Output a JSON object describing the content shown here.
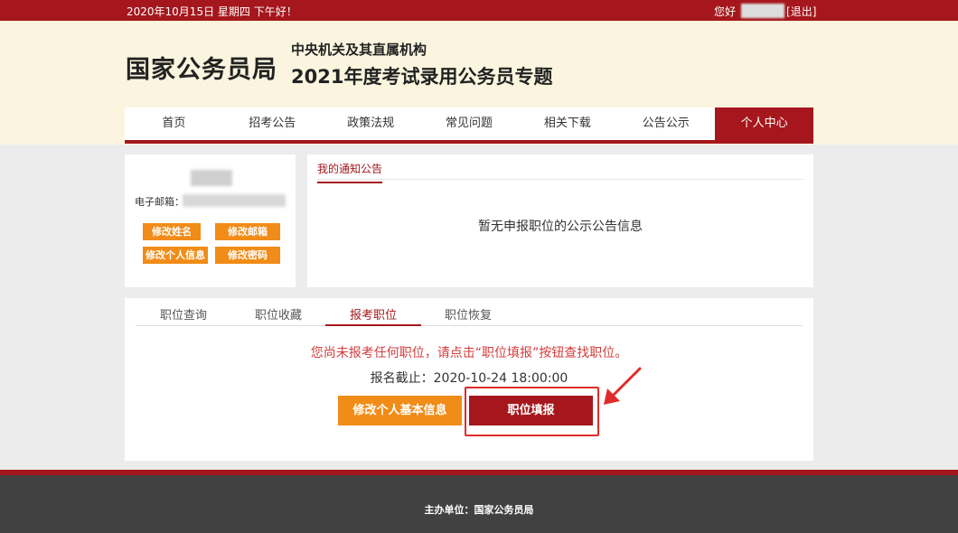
{
  "topbar": {
    "date_text": "2020年10月15日  星期四  下午好！",
    "greeting": "您好",
    "logout": "[退出]"
  },
  "header": {
    "logo": "国家公务员局",
    "subtitle_line1": "中央机关及其直属机构",
    "subtitle_line2": "2021年度考试录用公务员专题"
  },
  "nav": {
    "items": [
      "首页",
      "招考公告",
      "政策法规",
      "常见问题",
      "相关下载",
      "公告公示",
      "个人中心"
    ],
    "active": "个人中心"
  },
  "profile": {
    "email_label": "电子邮箱：",
    "buttons": [
      "修改姓名",
      "修改邮箱",
      "修改个人信息",
      "修改密码"
    ]
  },
  "notice": {
    "tab": "我的通知公告",
    "empty_message": "暂无申报职位的公示公告信息"
  },
  "main": {
    "tabs": [
      "职位查询",
      "职位收藏",
      "报考职位",
      "职位恢复"
    ],
    "active_tab": "报考职位",
    "warning": "您尚未报考任何职位，请点击“职位填报”按钮查找职位。",
    "deadline": "报名截止：2020-10-24 18:00:00",
    "edit_button": "修改个人基本信息",
    "apply_button": "职位填报"
  },
  "footer": {
    "host": "主办单位：国家公务员局"
  },
  "colors": {
    "brand_red": "#a5171c",
    "orange": "#f08c17",
    "highlight": "#e12b2b"
  }
}
